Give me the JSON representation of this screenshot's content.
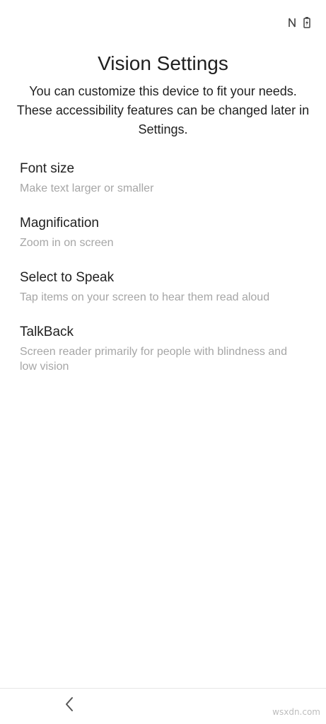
{
  "status_bar": {
    "icons": [
      "nfc-icon",
      "battery-charging-icon"
    ]
  },
  "header": {
    "title": "Vision Settings",
    "subtitle": "You can customize this device to fit your needs. These accessibility features can be changed later in Settings."
  },
  "options": [
    {
      "title": "Font size",
      "description": "Make text larger or smaller"
    },
    {
      "title": "Magnification",
      "description": "Zoom in on screen"
    },
    {
      "title": "Select to Speak",
      "description": "Tap items on your screen to hear them read aloud"
    },
    {
      "title": "TalkBack",
      "description": "Screen reader primarily for people with blindness and low vision"
    }
  ],
  "nav_bar": {
    "back_icon": "chevron-left-icon"
  },
  "watermark": "wsxdn.com",
  "colors": {
    "background": "#ffffff",
    "text_primary": "#1f1f1f",
    "text_secondary": "#a6a6a6",
    "divider": "#e6e6e6"
  }
}
